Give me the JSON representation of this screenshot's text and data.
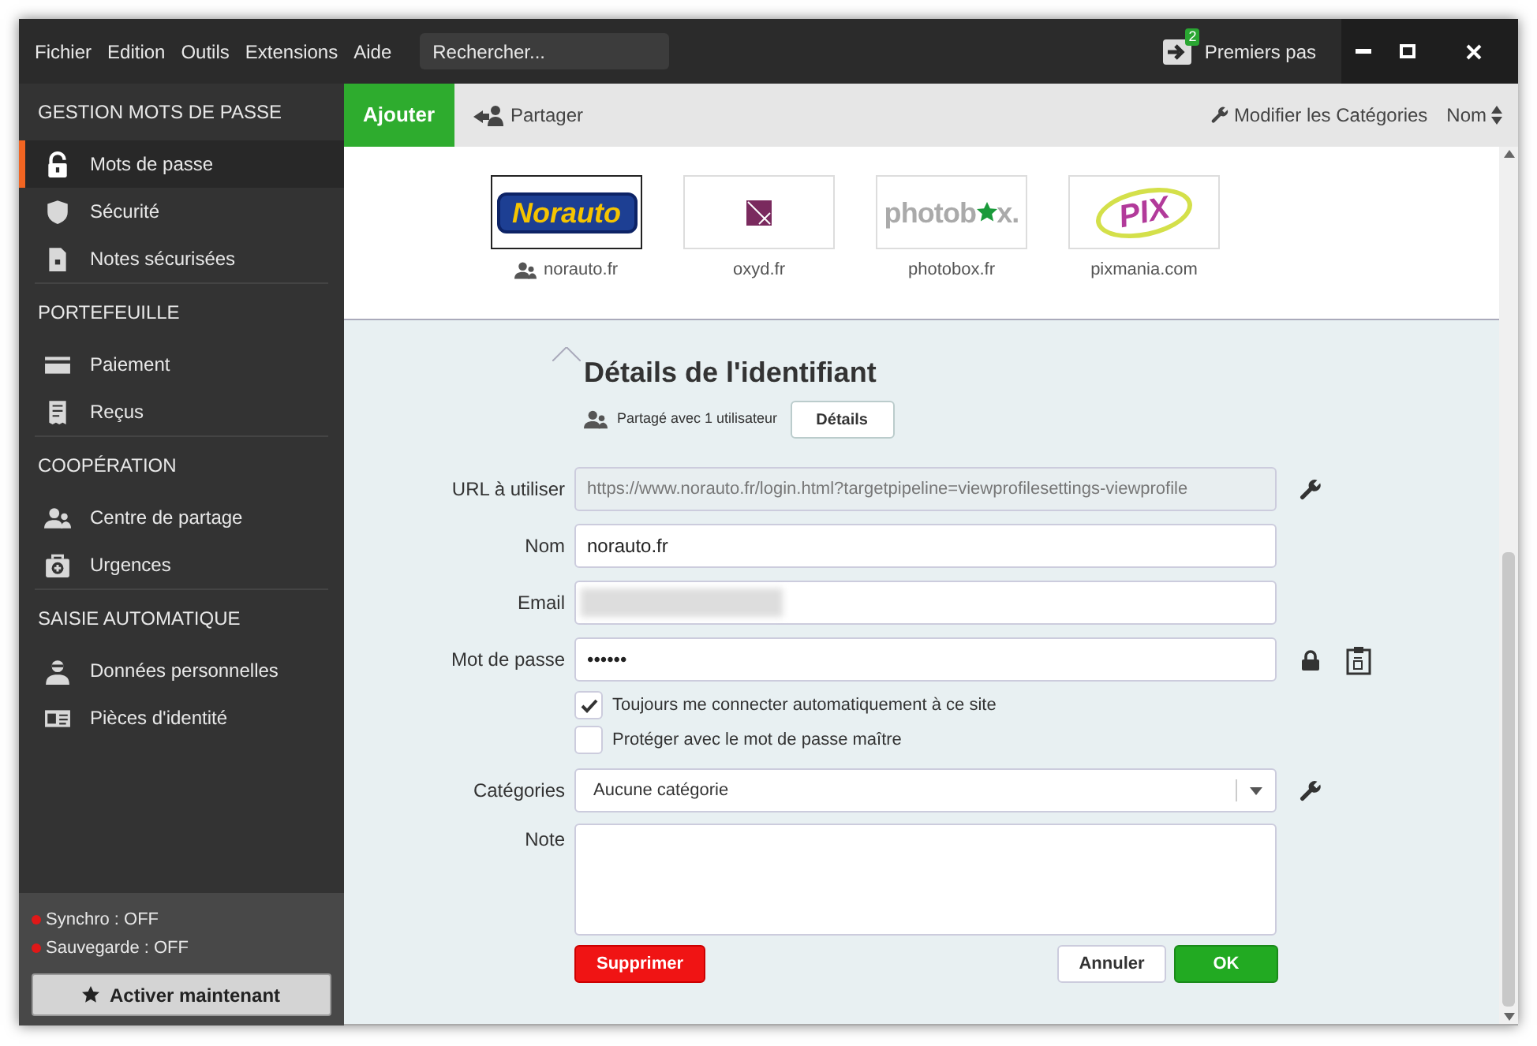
{
  "menu": [
    "Fichier",
    "Edition",
    "Outils",
    "Extensions",
    "Aide"
  ],
  "search": {
    "placeholder": "Rechercher..."
  },
  "getting_started": {
    "label": "Premiers pas",
    "badge": "2"
  },
  "sidebar": [
    {
      "title": "GESTION MOTS DE PASSE",
      "items": [
        {
          "label": "Mots de passe",
          "kind": "lock",
          "selected": true
        },
        {
          "label": "Sécurité",
          "kind": "shield",
          "selected": false
        },
        {
          "label": "Notes sécurisées",
          "kind": "note",
          "selected": false
        }
      ]
    },
    {
      "title": "PORTEFEUILLE",
      "items": [
        {
          "label": "Paiement",
          "kind": "card",
          "selected": false
        },
        {
          "label": "Reçus",
          "kind": "receipt",
          "selected": false
        }
      ]
    },
    {
      "title": "COOPÉRATION",
      "items": [
        {
          "label": "Centre de partage",
          "kind": "users",
          "selected": false
        },
        {
          "label": "Urgences",
          "kind": "aid",
          "selected": false
        }
      ]
    },
    {
      "title": "SAISIE AUTOMATIQUE",
      "items": [
        {
          "label": "Données personnelles",
          "kind": "person",
          "selected": false
        },
        {
          "label": "Pièces d'identité",
          "kind": "idcard",
          "selected": false
        }
      ]
    }
  ],
  "status": [
    {
      "label": "Synchro : OFF",
      "color": "#e01818"
    },
    {
      "label": "Sauvegarde : OFF",
      "color": "#e01818"
    }
  ],
  "activate_button": "Activer maintenant",
  "toolbar": {
    "add": "Ajouter",
    "share": "Partager",
    "edit_categories": "Modifier les Catégories",
    "sort": "Nom"
  },
  "sites": [
    {
      "name": "norauto.fr",
      "kind": "norauto",
      "logo": [
        "Norauto"
      ],
      "shared": true,
      "selected": true
    },
    {
      "name": "oxyd.fr",
      "kind": "oxyd",
      "shared": false,
      "selected": false
    },
    {
      "name": "photobox.fr",
      "kind": "photobox",
      "logo": [
        "photob",
        "x."
      ],
      "shared": false,
      "selected": false
    },
    {
      "name": "pixmania.com",
      "kind": "pix",
      "logo": [
        "PIX"
      ],
      "shared": false,
      "selected": false
    }
  ],
  "details": {
    "title": "Détails de l'identifiant",
    "shared_with": "Partagé avec 1 utilisateur",
    "details_button": "Détails",
    "fields": [
      {
        "label": "URL à utiliser",
        "kind": "url",
        "value": "https://www.norauto.fr/login.html?targetpipeline=viewprofilesettings-viewprofile"
      },
      {
        "label": "Nom",
        "kind": "text",
        "value": "norauto.fr"
      },
      {
        "label": "Email",
        "kind": "blurred"
      },
      {
        "label": "Mot de passe",
        "kind": "password",
        "value": "••••••"
      }
    ],
    "checkboxes": [
      {
        "label": "Toujours me connecter automatiquement à ce site",
        "checked": true
      },
      {
        "label": "Protéger avec le mot de passe maître",
        "checked": false
      }
    ],
    "category": {
      "label": "Catégories",
      "value": "Aucune catégorie"
    },
    "note": {
      "label": "Note"
    },
    "buttons": {
      "delete": "Supprimer",
      "cancel": "Annuler",
      "ok": "OK"
    }
  }
}
